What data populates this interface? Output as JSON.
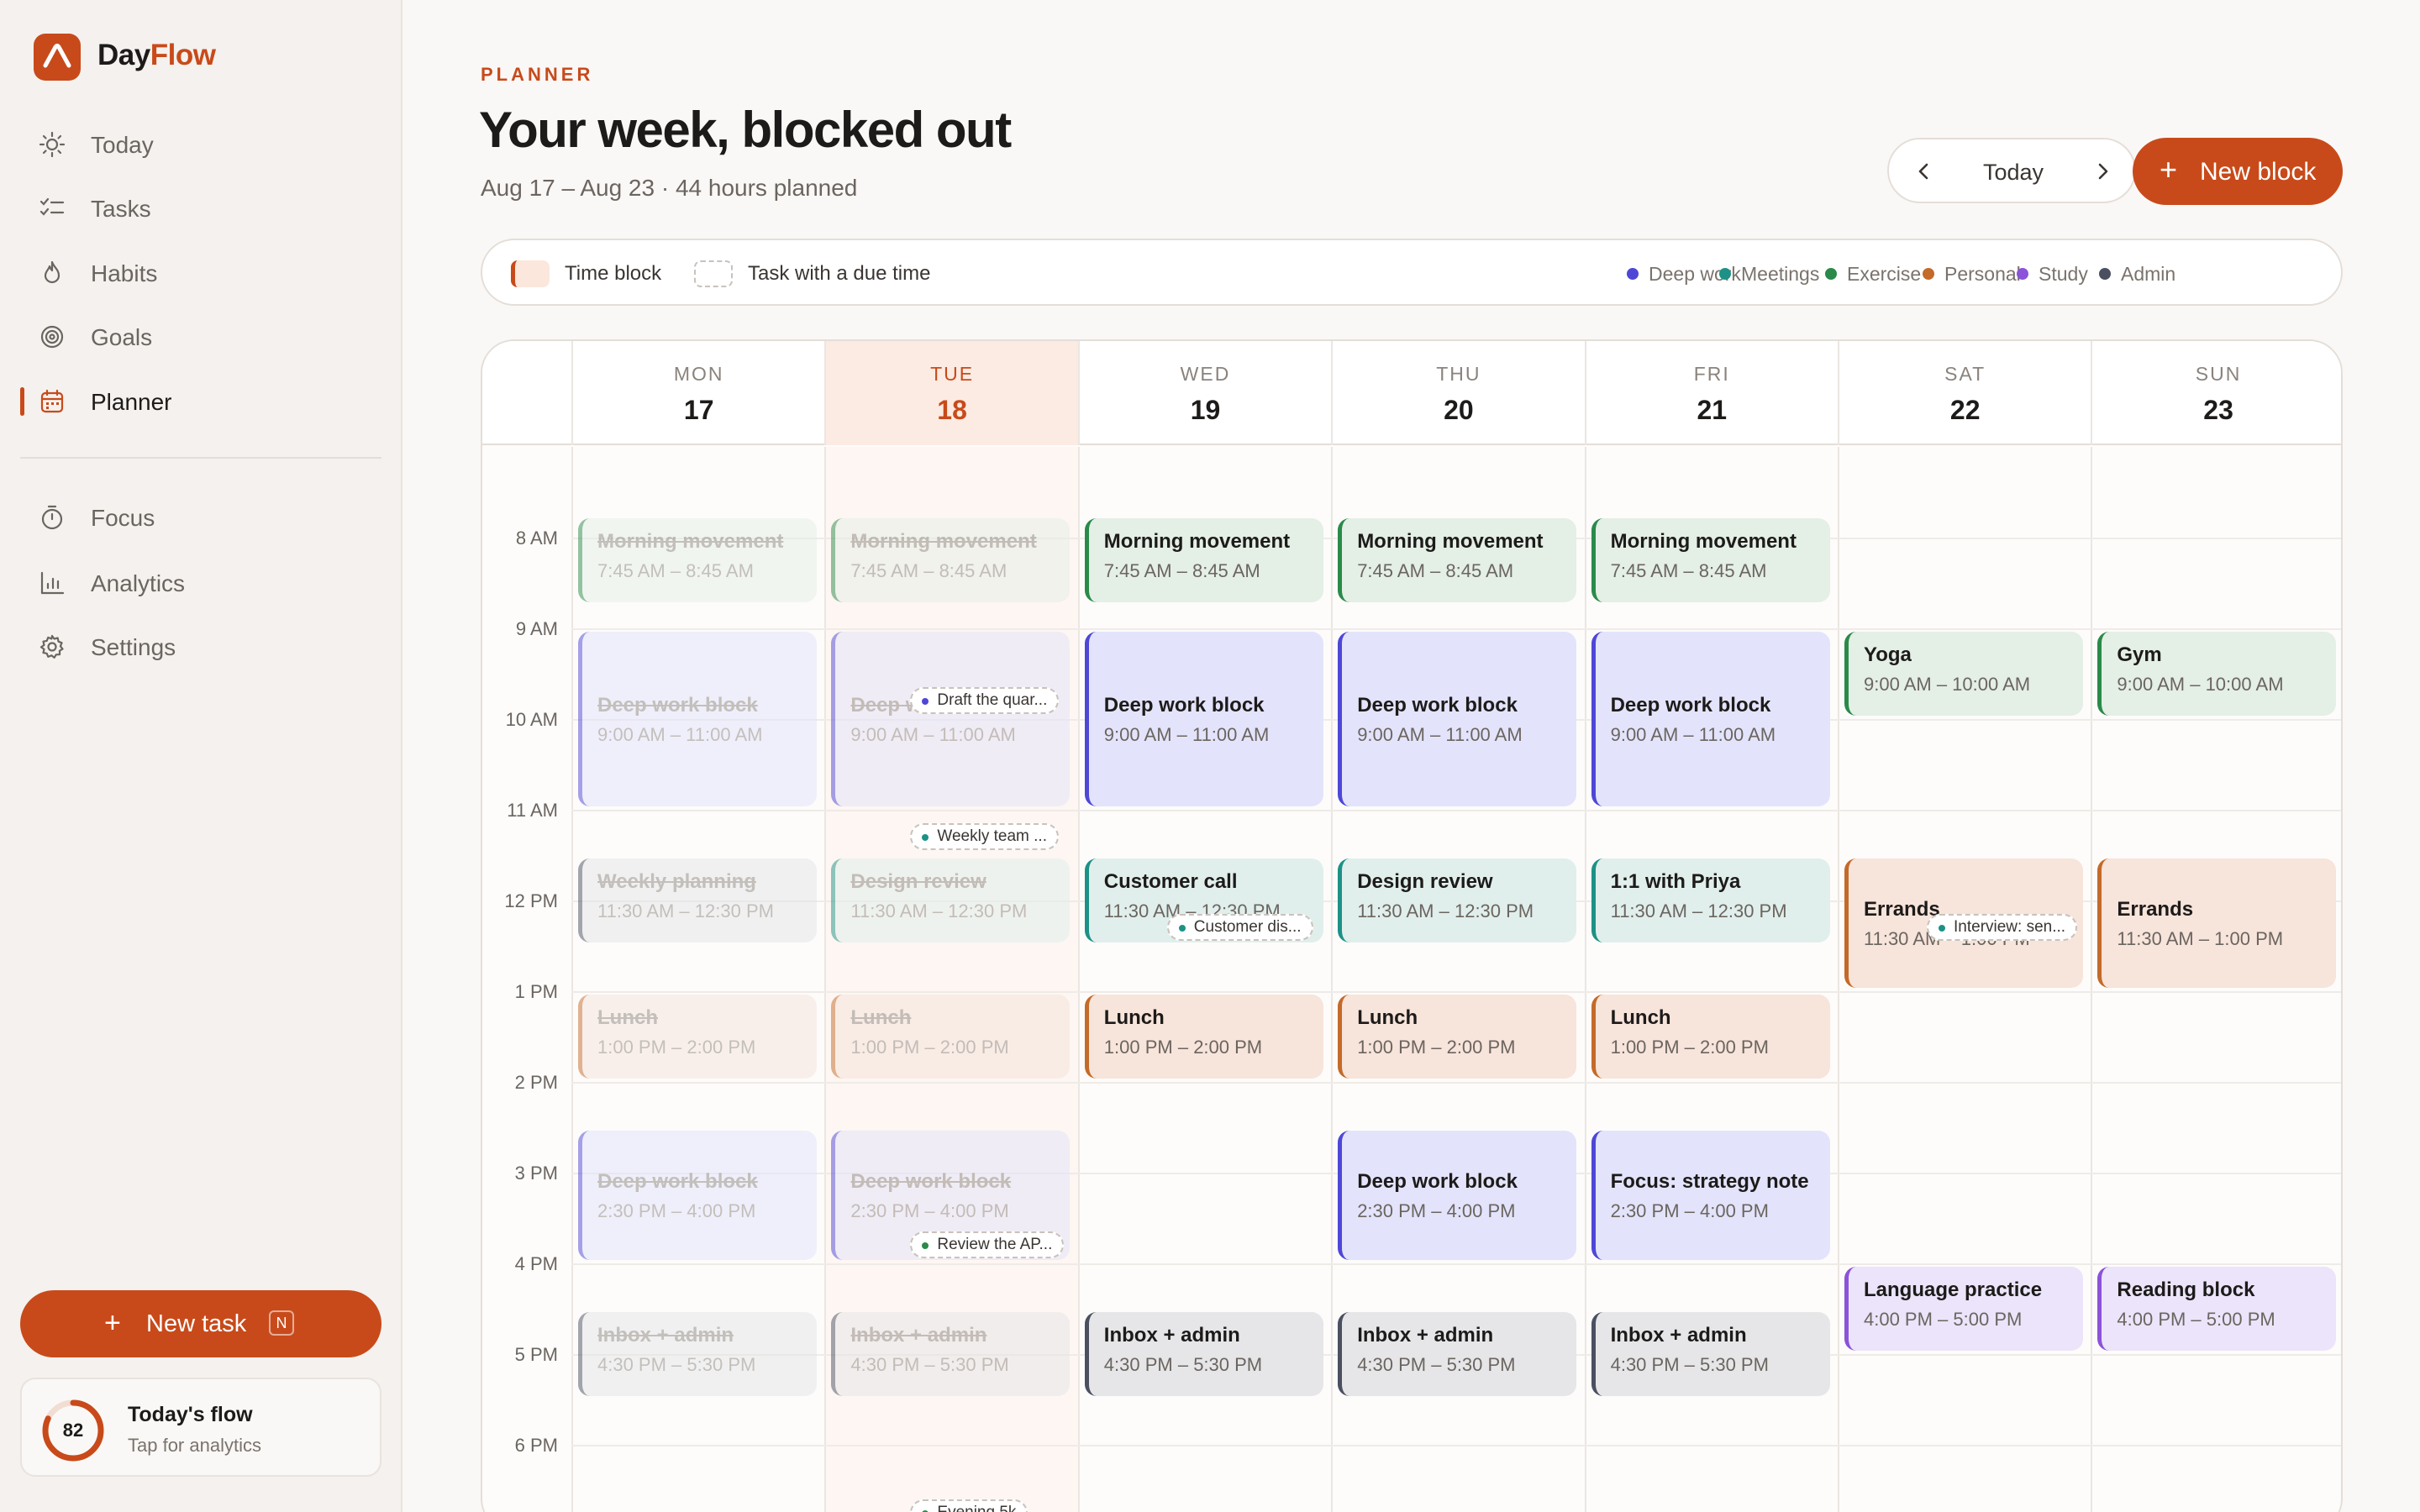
{
  "brand": {
    "name_a": "Day",
    "name_b": "Flow",
    "accent": "#c84a1a"
  },
  "nav": {
    "items": [
      {
        "label": "Today",
        "icon": "sun-icon"
      },
      {
        "label": "Tasks",
        "icon": "checklist-icon"
      },
      {
        "label": "Habits",
        "icon": "flame-icon"
      },
      {
        "label": "Goals",
        "icon": "target-icon"
      },
      {
        "label": "Planner",
        "icon": "calendar-icon",
        "active": true
      }
    ],
    "secondary": [
      {
        "label": "Focus",
        "icon": "timer-icon"
      },
      {
        "label": "Analytics",
        "icon": "bar-chart-icon"
      },
      {
        "label": "Settings",
        "icon": "gear-icon"
      }
    ]
  },
  "new_task": {
    "label": "New task",
    "shortcut": "N"
  },
  "flow_card": {
    "score": "82",
    "score_value": 0.82,
    "title": "Today's flow",
    "subtitle": "Tap for analytics"
  },
  "header": {
    "eyebrow": "PLANNER",
    "title": "Your week, blocked out",
    "subtitle": "Aug 17 – Aug 23 · 44 hours planned",
    "today_label": "Today",
    "new_block_label": "New block"
  },
  "legend": {
    "time_block": "Time block",
    "task_due": "Task with a due time",
    "categories": [
      {
        "label": "Deep work",
        "color": "#4e47d6"
      },
      {
        "label": "Meetings",
        "color": "#1d9186"
      },
      {
        "label": "Exercise",
        "color": "#2b8a4a"
      },
      {
        "label": "Personal",
        "color": "#c46a2a"
      },
      {
        "label": "Study",
        "color": "#8c52d9"
      },
      {
        "label": "Admin",
        "color": "#4a5060"
      }
    ]
  },
  "hours": [
    "8 AM",
    "9 AM",
    "10 AM",
    "11 AM",
    "12 PM",
    "1 PM",
    "2 PM",
    "3 PM",
    "4 PM",
    "5 PM",
    "6 PM"
  ],
  "days": [
    {
      "name": "MON",
      "date": "17"
    },
    {
      "name": "TUE",
      "date": "18",
      "today": true
    },
    {
      "name": "WED",
      "date": "19"
    },
    {
      "name": "THU",
      "date": "20"
    },
    {
      "name": "FRI",
      "date": "21"
    },
    {
      "name": "SAT",
      "date": "22"
    },
    {
      "name": "SUN",
      "date": "23"
    }
  ],
  "events": [
    {
      "day": 0,
      "title": "Morning movement",
      "time": "7:45 AM – 8:45 AM",
      "cat": "green",
      "start": 7.75,
      "end": 8.75,
      "past": true
    },
    {
      "day": 0,
      "title": "Deep work block",
      "time": "9:00 AM – 11:00 AM",
      "cat": "blue",
      "start": 9,
      "end": 11,
      "past": true
    },
    {
      "day": 0,
      "title": "Weekly planning",
      "time": "11:30 AM – 12:30 PM",
      "cat": "gray",
      "start": 11.5,
      "end": 12.5,
      "past": true
    },
    {
      "day": 0,
      "title": "Lunch",
      "time": "1:00 PM – 2:00 PM",
      "cat": "orange",
      "start": 13,
      "end": 14,
      "past": true
    },
    {
      "day": 0,
      "title": "Deep work block",
      "time": "2:30 PM – 4:00 PM",
      "cat": "blue",
      "start": 14.5,
      "end": 16,
      "past": true
    },
    {
      "day": 0,
      "title": "Inbox + admin",
      "time": "4:30 PM – 5:30 PM",
      "cat": "gray",
      "start": 16.5,
      "end": 17.5,
      "past": true
    },
    {
      "day": 1,
      "title": "Morning movement",
      "time": "7:45 AM – 8:45 AM",
      "cat": "green",
      "start": 7.75,
      "end": 8.75,
      "past": true
    },
    {
      "day": 1,
      "title": "Deep work block",
      "time": "9:00 AM – 11:00 AM",
      "cat": "blue",
      "start": 9,
      "end": 11,
      "past": true
    },
    {
      "day": 1,
      "title": "Design review",
      "time": "11:30 AM – 12:30 PM",
      "cat": "teal",
      "start": 11.5,
      "end": 12.5,
      "past": true
    },
    {
      "day": 1,
      "title": "Lunch",
      "time": "1:00 PM – 2:00 PM",
      "cat": "orange",
      "start": 13,
      "end": 14,
      "past": true
    },
    {
      "day": 1,
      "title": "Deep work block",
      "time": "2:30 PM – 4:00 PM",
      "cat": "blue",
      "start": 14.5,
      "end": 16,
      "past": true
    },
    {
      "day": 1,
      "title": "Inbox + admin",
      "time": "4:30 PM – 5:30 PM",
      "cat": "gray",
      "start": 16.5,
      "end": 17.5,
      "past": true
    },
    {
      "day": 2,
      "title": "Morning movement",
      "time": "7:45 AM – 8:45 AM",
      "cat": "green",
      "start": 7.75,
      "end": 8.75
    },
    {
      "day": 2,
      "title": "Deep work block",
      "time": "9:00 AM – 11:00 AM",
      "cat": "blue",
      "start": 9,
      "end": 11
    },
    {
      "day": 2,
      "title": "Customer call",
      "time": "11:30 AM – 12:30 PM",
      "cat": "teal",
      "start": 11.5,
      "end": 12.5
    },
    {
      "day": 2,
      "title": "Lunch",
      "time": "1:00 PM – 2:00 PM",
      "cat": "orange",
      "start": 13,
      "end": 14
    },
    {
      "day": 2,
      "title": "Inbox + admin",
      "time": "4:30 PM – 5:30 PM",
      "cat": "gray",
      "start": 16.5,
      "end": 17.5
    },
    {
      "day": 3,
      "title": "Morning movement",
      "time": "7:45 AM – 8:45 AM",
      "cat": "green",
      "start": 7.75,
      "end": 8.75
    },
    {
      "day": 3,
      "title": "Deep work block",
      "time": "9:00 AM – 11:00 AM",
      "cat": "blue",
      "start": 9,
      "end": 11
    },
    {
      "day": 3,
      "title": "Design review",
      "time": "11:30 AM – 12:30 PM",
      "cat": "teal",
      "start": 11.5,
      "end": 12.5
    },
    {
      "day": 3,
      "title": "Lunch",
      "time": "1:00 PM – 2:00 PM",
      "cat": "orange",
      "start": 13,
      "end": 14
    },
    {
      "day": 3,
      "title": "Deep work block",
      "time": "2:30 PM – 4:00 PM",
      "cat": "blue",
      "start": 14.5,
      "end": 16
    },
    {
      "day": 3,
      "title": "Inbox + admin",
      "time": "4:30 PM – 5:30 PM",
      "cat": "gray",
      "start": 16.5,
      "end": 17.5
    },
    {
      "day": 4,
      "title": "Morning movement",
      "time": "7:45 AM – 8:45 AM",
      "cat": "green",
      "start": 7.75,
      "end": 8.75
    },
    {
      "day": 4,
      "title": "Deep work block",
      "time": "9:00 AM – 11:00 AM",
      "cat": "blue",
      "start": 9,
      "end": 11
    },
    {
      "day": 4,
      "title": "1:1 with Priya",
      "time": "11:30 AM – 12:30 PM",
      "cat": "teal",
      "start": 11.5,
      "end": 12.5
    },
    {
      "day": 4,
      "title": "Lunch",
      "time": "1:00 PM – 2:00 PM",
      "cat": "orange",
      "start": 13,
      "end": 14
    },
    {
      "day": 4,
      "title": "Focus: strategy note",
      "time": "2:30 PM – 4:00 PM",
      "cat": "blue",
      "start": 14.5,
      "end": 16
    },
    {
      "day": 4,
      "title": "Inbox + admin",
      "time": "4:30 PM – 5:30 PM",
      "cat": "gray",
      "start": 16.5,
      "end": 17.5
    },
    {
      "day": 5,
      "title": "Yoga",
      "time": "9:00 AM – 10:00 AM",
      "cat": "green",
      "start": 9,
      "end": 10
    },
    {
      "day": 5,
      "title": "Errands",
      "time": "11:30 AM – 1:00 PM",
      "cat": "orange",
      "start": 11.5,
      "end": 13
    },
    {
      "day": 5,
      "title": "Language practice",
      "time": "4:00 PM – 5:00 PM",
      "cat": "purple",
      "start": 16,
      "end": 17
    },
    {
      "day": 6,
      "title": "Gym",
      "time": "9:00 AM – 10:00 AM",
      "cat": "green",
      "start": 9,
      "end": 10
    },
    {
      "day": 6,
      "title": "Errands",
      "time": "11:30 AM – 1:00 PM",
      "cat": "orange",
      "start": 11.5,
      "end": 13
    },
    {
      "day": 6,
      "title": "Reading block",
      "time": "4:00 PM – 5:00 PM",
      "cat": "purple",
      "start": 16,
      "end": 17
    }
  ],
  "tasks": [
    {
      "day": 1,
      "label": "Draft the quar...",
      "color": "#4e47d6",
      "at": 9.65
    },
    {
      "day": 1,
      "label": "Weekly team ...",
      "color": "#1d9186",
      "at": 11.15
    },
    {
      "day": 2,
      "label": "Customer dis...",
      "color": "#1d9186",
      "at": 12.15,
      "right": true
    },
    {
      "day": 5,
      "label": "Interview: sen...",
      "color": "#1d9186",
      "at": 12.15,
      "right": true
    },
    {
      "day": 1,
      "label": "Review the AP...",
      "color": "#2b8a4a",
      "at": 15.65
    },
    {
      "day": 1,
      "label": "Evening 5k",
      "color": "#2b8a4a",
      "at": 18.6
    }
  ]
}
